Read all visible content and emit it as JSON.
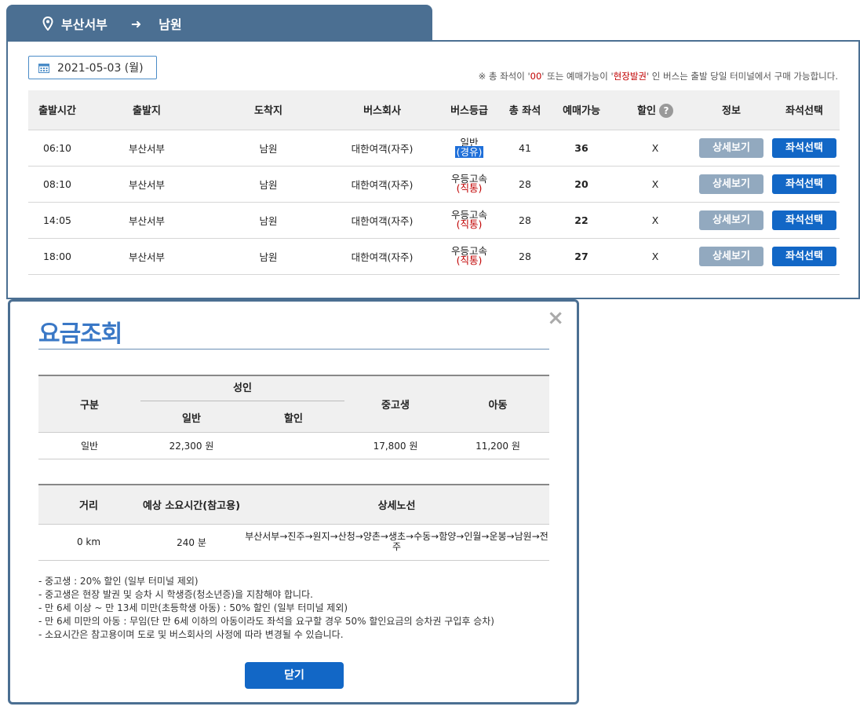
{
  "route": {
    "origin": "부산서부",
    "destination": "남원",
    "arrow": "➜"
  },
  "date": "2021-05-03 (월)",
  "notice": {
    "pre": "※ 총 좌석이 '",
    "highlight1": "00",
    "mid": "' 또는 예매가능이 '",
    "highlight2": "현장발권",
    "post": "' 인 버스는 출발 당일 터미널에서 구매 가능합니다."
  },
  "bus_table": {
    "headers": [
      "출발시간",
      "출발지",
      "도착지",
      "버스회사",
      "버스등급",
      "총 좌석",
      "예매가능",
      "할인",
      "정보",
      "좌석선택"
    ],
    "help_icon": "?",
    "rows": [
      {
        "time": "06:10",
        "from": "부산서부",
        "to": "남원",
        "company": "대한여객(자주)",
        "grade": "일반",
        "grade_tag": "(경유)",
        "total": "41",
        "available": "36",
        "discount": "X",
        "detail": "상세보기",
        "select": "좌석선택"
      },
      {
        "time": "08:10",
        "from": "부산서부",
        "to": "남원",
        "company": "대한여객(자주)",
        "grade": "우등고속",
        "grade_tag": "(직통)",
        "total": "28",
        "available": "20",
        "discount": "X",
        "detail": "상세보기",
        "select": "좌석선택"
      },
      {
        "time": "14:05",
        "from": "부산서부",
        "to": "남원",
        "company": "대한여객(자주)",
        "grade": "우등고속",
        "grade_tag": "(직통)",
        "total": "28",
        "available": "22",
        "discount": "X",
        "detail": "상세보기",
        "select": "좌석선택"
      },
      {
        "time": "18:00",
        "from": "부산서부",
        "to": "남원",
        "company": "대한여객(자주)",
        "grade": "우등고속",
        "grade_tag": "(직통)",
        "total": "28",
        "available": "27",
        "discount": "X",
        "detail": "상세보기",
        "select": "좌석선택"
      }
    ]
  },
  "modal": {
    "title": "요금조회",
    "close": "×",
    "fare_table": {
      "h_category": "구분",
      "h_adult": "성인",
      "h_student": "중고생",
      "h_child": "아동",
      "h_normal": "일반",
      "h_discount": "할인",
      "row": {
        "category": "일반",
        "adult_normal": "22,300 원",
        "adult_discount": "",
        "student": "17,800 원",
        "child": "11,200 원"
      }
    },
    "route_table": {
      "h_distance": "거리",
      "h_time": "예상 소요시간(참고용)",
      "h_path": "상세노선",
      "row": {
        "distance": "0 km",
        "time": "240 분",
        "path": "부산서부→진주→원지→산청→양촌→생초→수동→함양→인월→운봉→남원→전주"
      }
    },
    "notes": [
      "- 중고생 : 20% 할인 (일부 터미널 제외)",
      "- 중고생은 현장 발권 및 승차 시 학생증(청소년증)을 지참해야 합니다.",
      "- 만 6세 이상 ~ 만 13세 미만(초등학생 아동) : 50% 할인 (일부 터미널 제외)",
      "- 만 6세 미만의 아동 : 무임(단 만 6세 이하의 아동이라도 좌석을 요구할 경우 50% 할인요금의 승차권 구입후 승차)",
      "- 소요시간은 참고용이며 도로 및 버스회사의 사정에 따라 변경될 수 있습니다."
    ],
    "close_button": "닫기"
  },
  "colors": {
    "header_bg": "#4b6f92",
    "primary_button": "#1267c6",
    "detail_button": "#92a9bf",
    "title_blue": "#3a78c6",
    "accent_red": "#c00000"
  },
  "icons": [
    "location-pin-icon",
    "arrow-right-icon",
    "calendar-icon",
    "help-icon",
    "close-icon"
  ]
}
